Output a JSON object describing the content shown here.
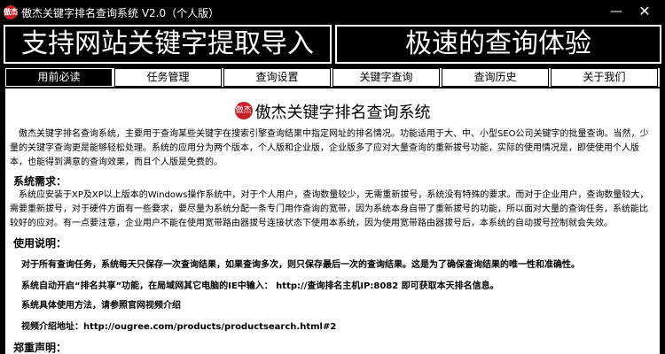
{
  "window": {
    "title": "傲杰关键字排名查询系统 V2.0（个人版）",
    "minimize_glyph": "—",
    "close_glyph": "✕",
    "logo_text": "傲杰"
  },
  "banner": {
    "left": "支持网站关键字提取导入",
    "right": "极速的查询体验"
  },
  "tabs": [
    {
      "label": "用前必读"
    },
    {
      "label": "任务管理"
    },
    {
      "label": "查询设置"
    },
    {
      "label": "关键字查询"
    },
    {
      "label": "查询历史"
    },
    {
      "label": "关于我们"
    }
  ],
  "content": {
    "title": "傲杰关键字排名查询系统",
    "intro": "傲杰关键字排名查询系统，主要用于查询某些关键字在搜索引擎查询结果中指定网址的排名情况。功能适用于大、中、小型SEO公司关键字的批量查询。当然，少量的关键字查询更是能够轻松处理。系统的应用分为两个版本，个人版和企业版，企业版多了应对大量查询的重新拔号功能，实际的使用情况是，即使使用个人版本，也能得到满意的查询效果，而且个人版是免费的。",
    "req_heading": "系统需求：",
    "req_text": "系统应安装于XP及XP以上版本的Windows操作系统中，对于个人用户，查询数量较少，无需重新拔号，系统没有特殊的要求。而对于企业用户，查询数量较大，需要重新拔号，对于硬件方面有一些要求，要尽量为系统分配一条专门用作查询的宽带，因为系统本身自带了重新拔号的功能，所以面对大量的查询任务，系统能比较好的应对。有一点要注意，企业用户不能在使用宽带路由器拔号连接状态下使用本系统，因为使用宽带路由器拔号后，本系统的自动拔号控制就会失效。",
    "usage_heading": "使用说明：",
    "usage_1": "对于所有查询任务，系统每天只保存一次查询结果，如果查询多次，则只保存最后一次的查询结果。这是为了确保查询结果的唯一性和准确性。",
    "usage_2": "系统自动开启“排名共享”功能，在局域网其它电脑的IE中输入：   http://查询排名主机IP:8082  即可获取本天排名信息。",
    "usage_3": "系统具体使用方法，请参照官网视频介绍",
    "usage_4": "视频介绍地址：http://ougree.com/products/productsearch.html#2",
    "disclaimer_heading": "郑重声明："
  }
}
